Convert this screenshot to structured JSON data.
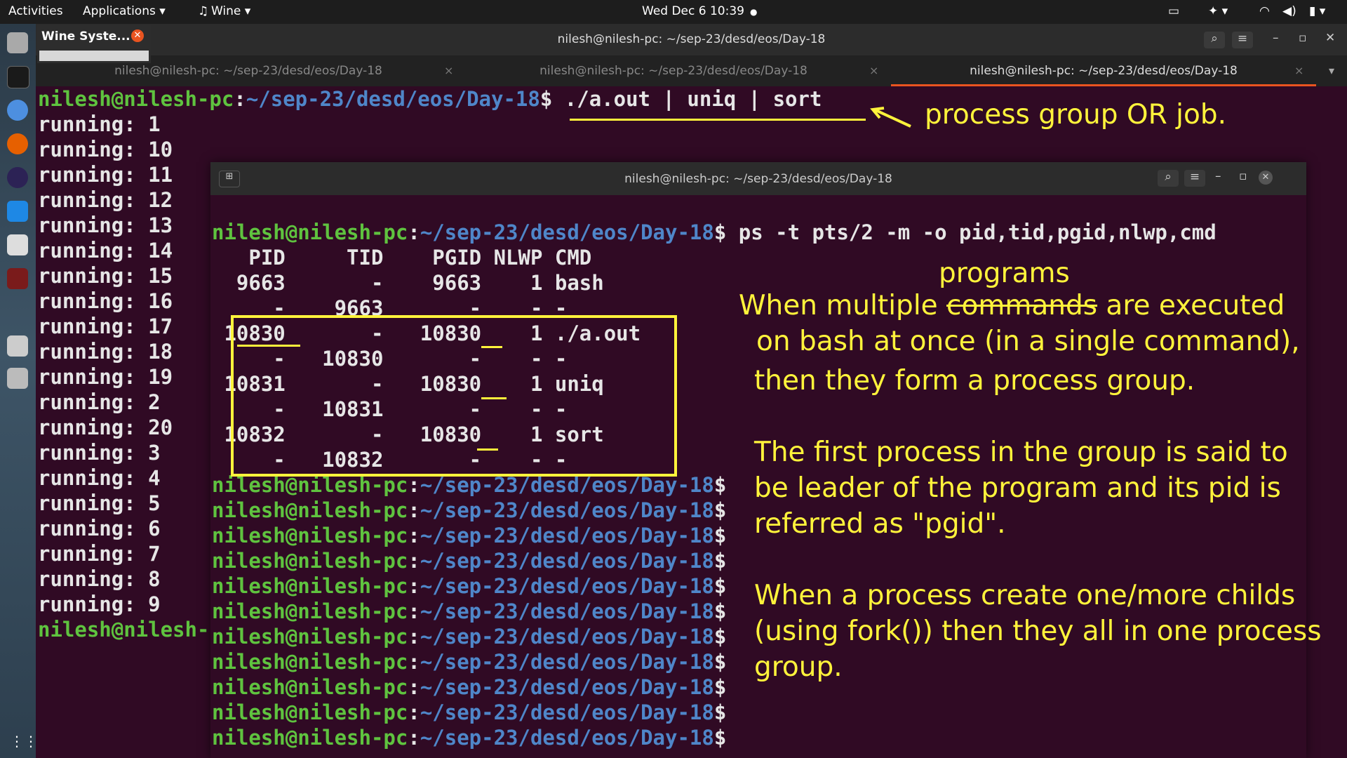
{
  "topbar": {
    "activities": "Activities",
    "applications": "Applications ▾",
    "wine": "Wine ▾",
    "clock": "Wed Dec 6  10:39",
    "dot": "●"
  },
  "wine_popup": {
    "title": "Wine Syste..."
  },
  "window": {
    "title": "nilesh@nilesh-pc: ~/sep-23/desd/eos/Day-18",
    "tabs": [
      {
        "label": "nilesh@nilesh-pc: ~/sep-23/desd/eos/Day-18"
      },
      {
        "label": "nilesh@nilesh-pc: ~/sep-23/desd/eos/Day-18"
      },
      {
        "label": "nilesh@nilesh-pc: ~/sep-23/desd/eos/Day-18"
      }
    ]
  },
  "outer_terminal": {
    "prompt_user": "nilesh@nilesh-pc",
    "prompt_path": "~/sep-23/desd/eos/Day-18",
    "command": "$ ./a.out | uniq | sort",
    "output": [
      "running: 1",
      "running: 10",
      "running: 11",
      "running: 12",
      "running: 13",
      "running: 14",
      "running: 15",
      "running: 16",
      "running: 17",
      "running: 18",
      "running: 19",
      "running: 2",
      "running: 20",
      "running: 3",
      "running: 4",
      "running: 5",
      "running: 6",
      "running: 7",
      "running: 8",
      "running: 9"
    ],
    "last_prompt": "nilesh@nilesh-"
  },
  "inner_terminal": {
    "title": "nilesh@nilesh-pc: ~/sep-23/desd/eos/Day-18",
    "prompt_user": "nilesh@nilesh-pc",
    "prompt_path": "~/sep-23/desd/eos/Day-18",
    "command": "$ ps -t pts/2 -m -o pid,tid,pgid,nlwp,cmd",
    "ps_header": "   PID     TID    PGID NLWP CMD",
    "ps_rows": [
      "  9663       -    9663    1 bash",
      "     -    9663       -    - -",
      " 10830       -   10830    1 ./a.out",
      "     -   10830       -    - -",
      " 10831       -   10830    1 uniq",
      "     -   10831       -    - -",
      " 10832       -   10830    1 sort",
      "     -   10832       -    - -"
    ],
    "empty_prompts": 11,
    "dollar": "$"
  },
  "annotations": {
    "arrow_note": "process group OR job.",
    "programs": "programs",
    "line1a": "When multiple ",
    "line1_struck": "commands",
    "line1b": " are executed",
    "line2": "on bash at once (in a single command),",
    "line3": "then they form a process group.",
    "line4": "The first process in the group is said to",
    "line5": "be leader of the program and its pid is",
    "line6": "referred as \"pgid\".",
    "line7": "When a process create one/more childs",
    "line8": "(using fork()) then they all in one process",
    "line9": "group."
  },
  "colors": {
    "bg": "#300a24",
    "prompt_user": "#5fc33f",
    "prompt_path": "#4f86c9",
    "annotation": "#fff33b",
    "accent": "#e95420"
  }
}
